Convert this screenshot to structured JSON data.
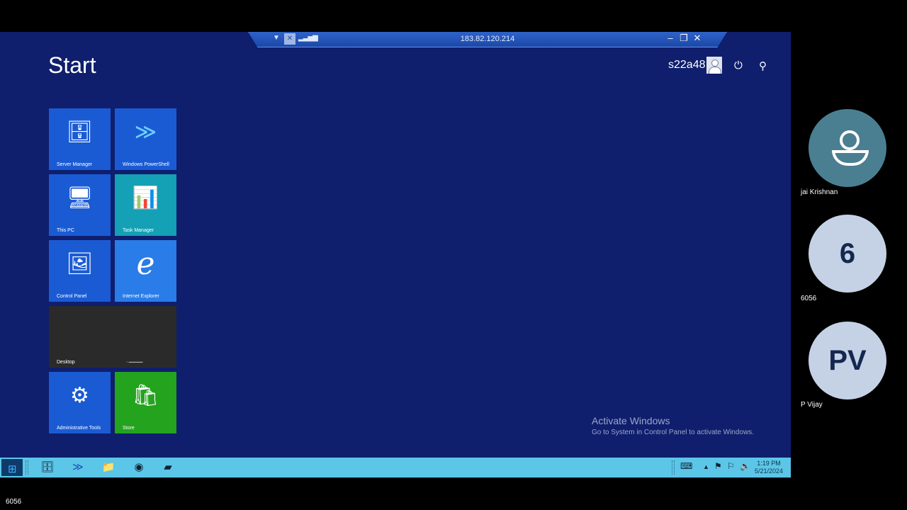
{
  "remote_session": {
    "ip": "183.82.120.214",
    "start_title": "Start",
    "user_name": "s22a48",
    "tiles": [
      {
        "label": "Server Manager",
        "icon": "server-manager-icon"
      },
      {
        "label": "Windows PowerShell",
        "icon": "powershell-icon"
      },
      {
        "label": "This PC",
        "icon": "computer-icon"
      },
      {
        "label": "Task Manager",
        "icon": "task-manager-icon"
      },
      {
        "label": "Control Panel",
        "icon": "control-panel-icon"
      },
      {
        "label": "Internet Explorer",
        "icon": "internet-explorer-icon"
      },
      {
        "label": "Desktop",
        "icon": "desktop-tile"
      },
      {
        "label": "Administrative Tools",
        "icon": "admin-tools-icon"
      },
      {
        "label": "Store",
        "icon": "store-icon"
      }
    ],
    "activate": {
      "title": "Activate Windows",
      "subtitle": "Go to System in Control Panel to activate Windows."
    },
    "clock": {
      "time": "1:19 PM",
      "date": "5/21/2024"
    }
  },
  "participants": [
    {
      "name": "jai Krishnan",
      "initial": ""
    },
    {
      "name": "6056",
      "initial": "6"
    },
    {
      "name": "P Vijay",
      "initial": "PV"
    }
  ],
  "bottom_label": "6056"
}
